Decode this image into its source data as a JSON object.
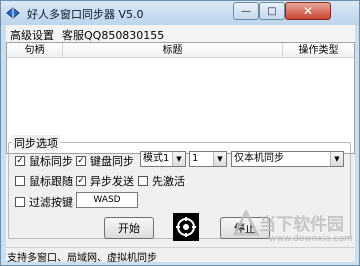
{
  "window": {
    "title": "好人多窗口同步器 V5.0",
    "minimize_glyph": "—",
    "maximize_glyph": "□",
    "close_glyph": "✕",
    "icon": "app-icon"
  },
  "menubar": {
    "items": [
      "高级设置",
      "客服QQ850830155"
    ]
  },
  "listview": {
    "columns": [
      "句柄",
      "标题",
      "操作类型"
    ],
    "rows": []
  },
  "sync_options": {
    "group_label": "同步选项",
    "mouse_sync": {
      "label": "鼠标同步",
      "checked": true
    },
    "keyboard_sync": {
      "label": "键盘同步",
      "checked": true
    },
    "mode_select": {
      "value": "模式1"
    },
    "count_select": {
      "value": "1"
    },
    "scope_select": {
      "value": "仅本机同步"
    },
    "mouse_follow": {
      "label": "鼠标跟随",
      "checked": false
    },
    "async_send": {
      "label": "异步发送",
      "checked": true
    },
    "activate_first": {
      "label": "先激活",
      "checked": false
    },
    "filter_keys": {
      "label": "过滤按键",
      "checked": false
    },
    "filter_value": "WASD"
  },
  "buttons": {
    "start": "开始",
    "stop": "停止"
  },
  "statusbar": {
    "text": "支持多窗口、局域网、虚拟机同步"
  },
  "watermark": {
    "text": "当下软件园",
    "url": "www.downxia.com"
  },
  "colors": {
    "titlebar": "#c9dff0",
    "close": "#c84532",
    "client": "#f0f0f0"
  }
}
